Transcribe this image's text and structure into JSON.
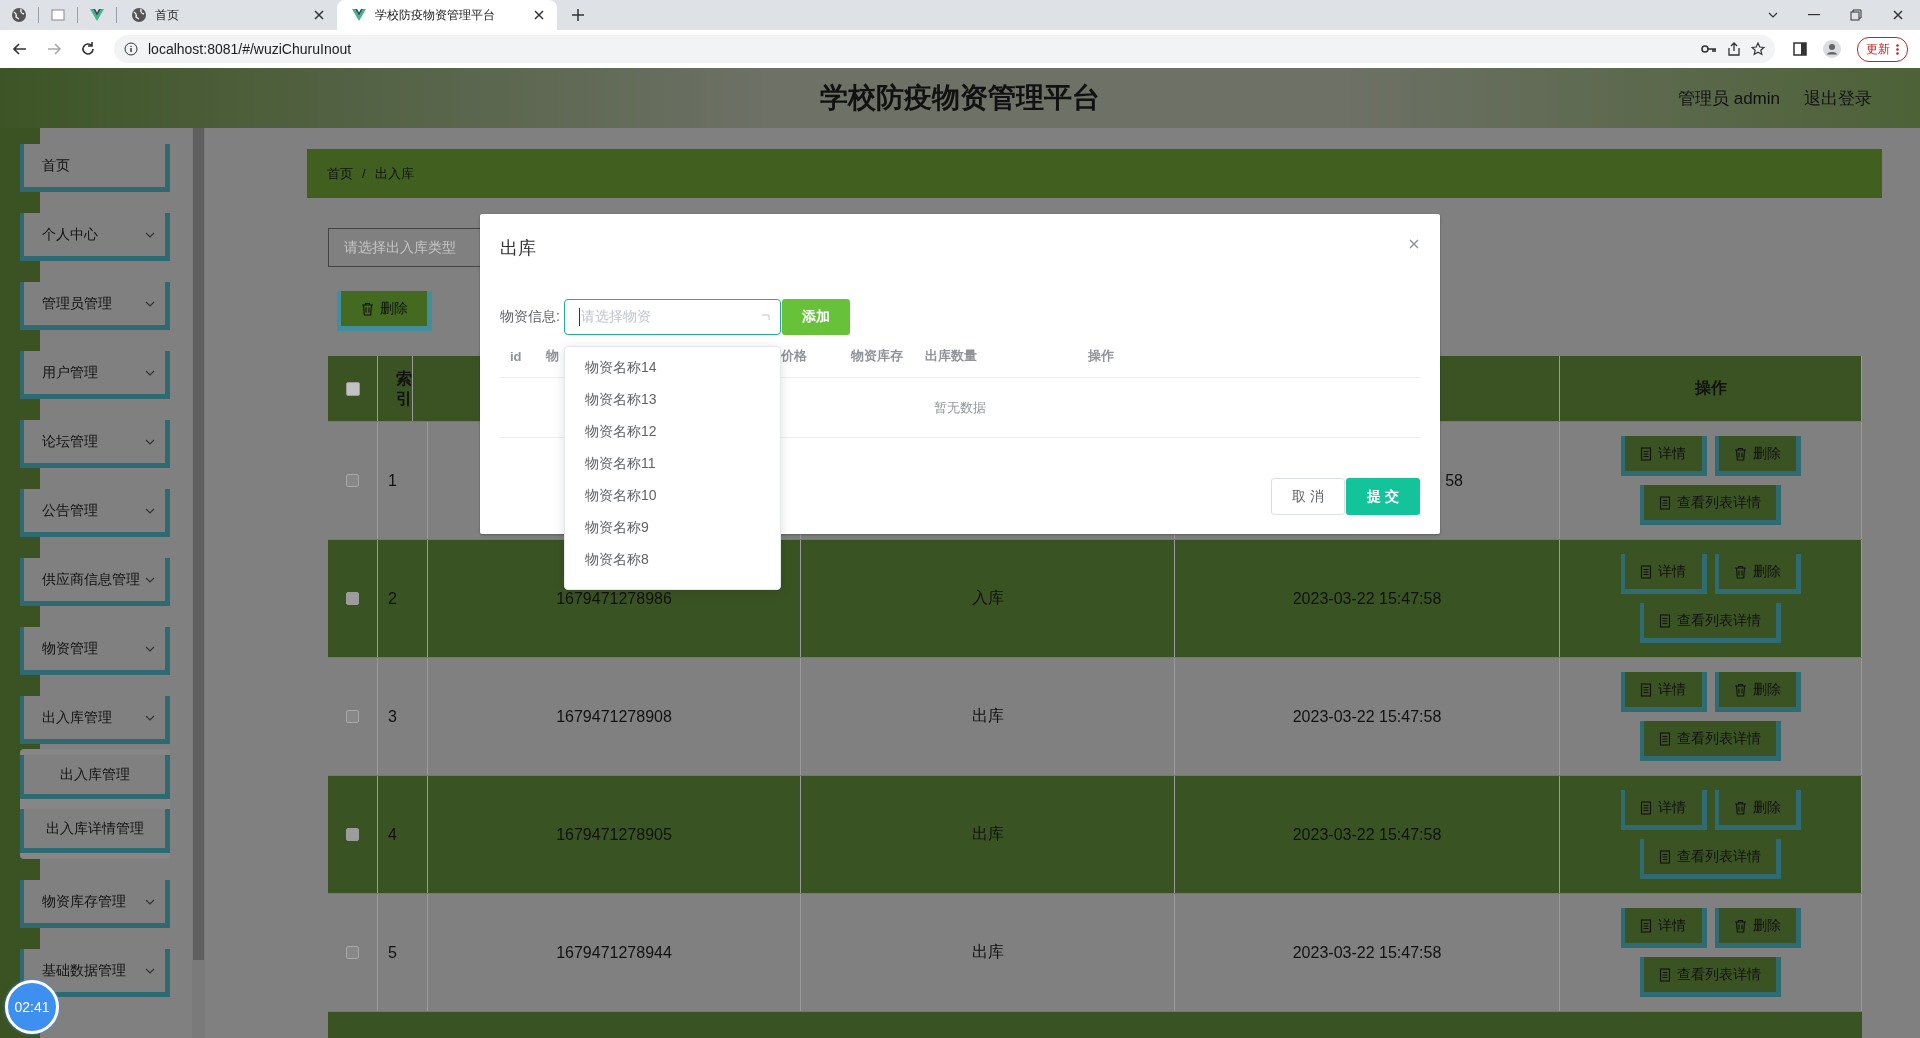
{
  "browser": {
    "tabs": [
      {
        "title": "首页",
        "selected": false
      },
      {
        "title": "学校防疫物资管理平台",
        "selected": true
      }
    ],
    "address": "localhost:8081/#/wuziChuruInout",
    "update_button": "更新"
  },
  "header": {
    "title": "学校防疫物资管理平台",
    "user": "管理员 admin",
    "logout": "退出登录"
  },
  "sidebar": {
    "items": [
      {
        "label": "首页",
        "kind": "link"
      },
      {
        "label": "个人中心",
        "kind": "submenu"
      },
      {
        "label": "管理员管理",
        "kind": "submenu"
      },
      {
        "label": "用户管理",
        "kind": "submenu"
      },
      {
        "label": "论坛管理",
        "kind": "submenu"
      },
      {
        "label": "公告管理",
        "kind": "submenu"
      },
      {
        "label": "供应商信息管理",
        "kind": "submenu"
      },
      {
        "label": "物资管理",
        "kind": "submenu"
      },
      {
        "label": "出入库管理",
        "kind": "submenu",
        "children": [
          {
            "label": "出入库管理"
          },
          {
            "label": "出入库详情管理"
          }
        ]
      },
      {
        "label": "物资库存管理",
        "kind": "submenu"
      },
      {
        "label": "基础数据管理",
        "kind": "submenu"
      }
    ]
  },
  "timer": "02:41",
  "breadcrumb": {
    "items": [
      "首页",
      "出入库"
    ],
    "separator": "/"
  },
  "search": {
    "placeholder": "请选择出入库类型"
  },
  "delete_button": "删除",
  "table": {
    "all_checked": false,
    "index_header": "索引",
    "actions_header": "操作",
    "rows": [
      {
        "index": "1",
        "checked": false,
        "time": "58",
        "actions": [
          "详情",
          "删除",
          "查看列表详情"
        ]
      },
      {
        "index": "2",
        "checked": false,
        "number": "1679471278986",
        "type": "入库",
        "time": "2023-03-22 15:47:58",
        "actions": [
          "详情",
          "删除",
          "查看列表详情"
        ]
      },
      {
        "index": "3",
        "checked": false,
        "number": "1679471278908",
        "type": "出库",
        "time": "2023-03-22 15:47:58",
        "actions": [
          "详情",
          "删除",
          "查看列表详情"
        ]
      },
      {
        "index": "4",
        "checked": false,
        "number": "1679471278905",
        "type": "出库",
        "time": "2023-03-22 15:47:58",
        "actions": [
          "详情",
          "删除",
          "查看列表详情"
        ]
      },
      {
        "index": "5",
        "checked": false,
        "number": "1679471278944",
        "type": "出库",
        "time": "2023-03-22 15:47:58",
        "actions": [
          "详情",
          "删除",
          "查看列表详情"
        ]
      }
    ]
  },
  "dialog": {
    "title": "出库",
    "field_label": "物资信息:",
    "select_placeholder": "请选择物资",
    "add_button": "添加",
    "columns": [
      "id",
      "物",
      "价格",
      "物资库存",
      "出库数量",
      "操作"
    ],
    "empty_text": "暂无数据",
    "cancel_button": "取 消",
    "submit_button": "提 交",
    "options": [
      "物资名称14",
      "物资名称13",
      "物资名称12",
      "物资名称11",
      "物资名称10",
      "物资名称9",
      "物资名称8"
    ]
  }
}
